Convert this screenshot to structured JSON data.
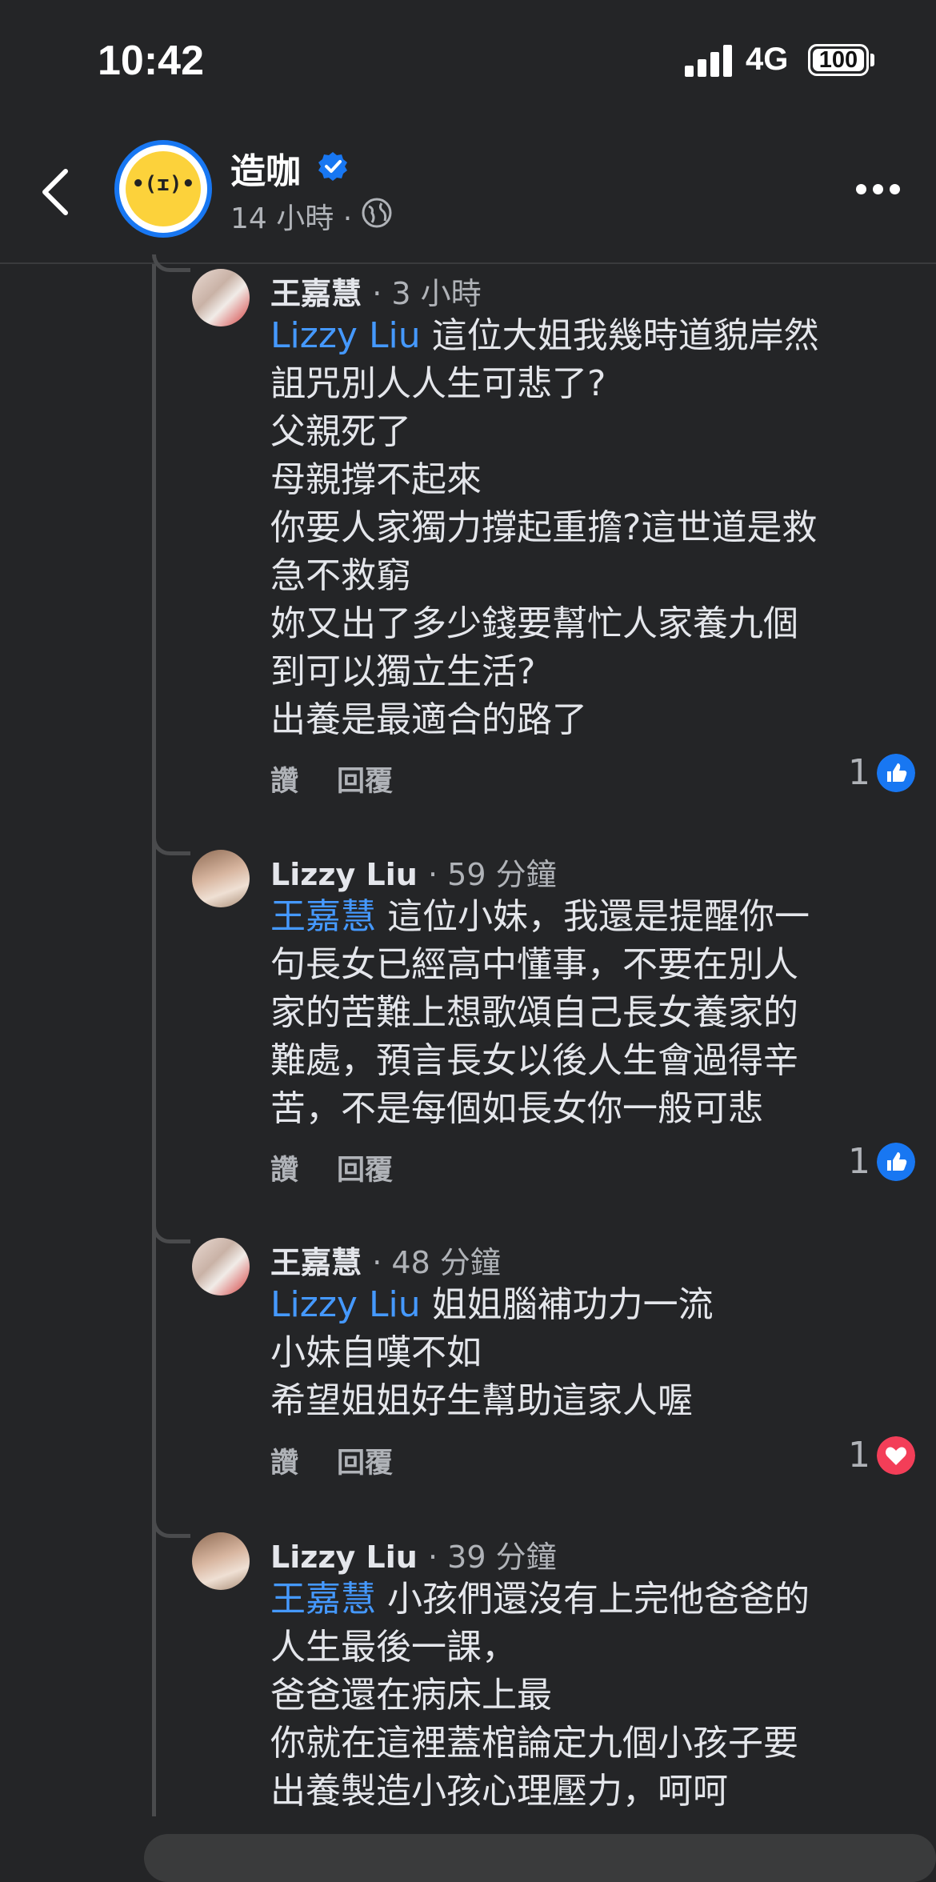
{
  "status": {
    "time": "10:42",
    "network": "4G",
    "battery": "100"
  },
  "header": {
    "page_name": "造咖",
    "post_meta": "14 小時 ·"
  },
  "comments": [
    {
      "author": "王嘉慧",
      "time": "· 3 小時",
      "mention": "Lizzy Liu",
      "first_line": " 這位大姐我幾時道貌岸然",
      "lines": [
        "詛咒別人人生可悲了?",
        "父親死了",
        "母親撐不起來",
        "你要人家獨力撐起重擔?這世道是救",
        "急不救窮",
        "妳又出了多少錢要幫忙人家養九個",
        "到可以獨立生活?",
        "出養是最適合的路了"
      ],
      "like_label": "讚",
      "reply_label": "回覆",
      "reaction_count": "1",
      "reaction_type": "like"
    },
    {
      "author": "Lizzy Liu",
      "time": "· 59 分鐘",
      "mention": "王嘉慧",
      "first_line": " 這位小妹，我還是提醒你一",
      "lines": [
        "句長女已經高中懂事，不要在別人",
        "家的苦難上想歌頌自己長女養家的",
        "難處，預言長女以後人生會過得辛",
        "苦，不是每個如長女你一般可悲"
      ],
      "like_label": "讚",
      "reply_label": "回覆",
      "reaction_count": "1",
      "reaction_type": "like"
    },
    {
      "author": "王嘉慧",
      "time": "· 48 分鐘",
      "mention": "Lizzy Liu",
      "first_line": " 姐姐腦補功力一流",
      "lines": [
        "小妹自嘆不如",
        "希望姐姐好生幫助這家人喔"
      ],
      "like_label": "讚",
      "reply_label": "回覆",
      "reaction_count": "1",
      "reaction_type": "love"
    },
    {
      "author": "Lizzy Liu",
      "time": "· 39 分鐘",
      "mention": "王嘉慧",
      "first_line": " 小孩們還沒有上完他爸爸的",
      "lines": [
        "人生最後一課，",
        "爸爸還在病床上最",
        "你就在這裡蓋棺論定九個小孩子要",
        "出養製造小孩心理壓力，呵呵"
      ]
    }
  ],
  "colors": {
    "background": "#242527",
    "mention": "#4599ff",
    "like": "#1877f2",
    "love": "#f33e58"
  }
}
